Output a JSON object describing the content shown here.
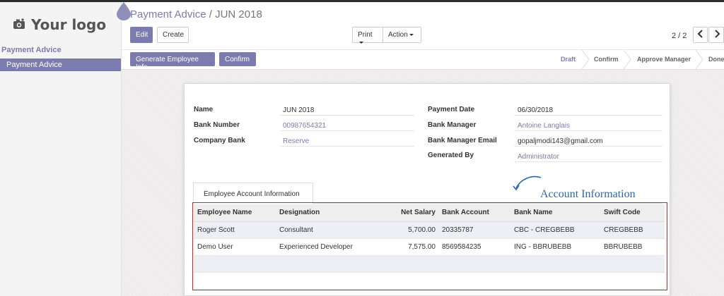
{
  "app": {
    "logo_text": "Your logo",
    "colors": {
      "accent": "#7c7bad",
      "annotation": "#2a67b0",
      "highlight_box": "#e02020"
    }
  },
  "sidebar": {
    "section_label": "Payment Advice",
    "items": [
      {
        "label": "Payment Advice",
        "active": true
      }
    ]
  },
  "breadcrumb": {
    "parent": "Payment Advice",
    "separator": "/",
    "current": "JUN 2018"
  },
  "toolbar": {
    "edit": "Edit",
    "create": "Create",
    "print": "Print",
    "action": "Action"
  },
  "pager": {
    "text": "2 / 2",
    "prev_icon": "chevron-left-icon",
    "next_icon": "chevron-right-icon"
  },
  "header_buttons": {
    "generate": "Generate Employee Info",
    "confirm": "Confirm"
  },
  "states": [
    {
      "label": "Draft",
      "active": true
    },
    {
      "label": "Confirm",
      "active": false
    },
    {
      "label": "Approve Manager",
      "active": false
    },
    {
      "label": "Done",
      "active": false
    }
  ],
  "form": {
    "left": [
      {
        "label": "Name",
        "value": "JUN 2018",
        "link": false
      },
      {
        "label": "Bank Number",
        "value": "00987654321",
        "link": true
      },
      {
        "label": "Company Bank",
        "value": "Reserve",
        "link": true
      }
    ],
    "right": [
      {
        "label": "Payment Date",
        "value": "06/30/2018",
        "link": false
      },
      {
        "label": "Bank Manager",
        "value": "Antoine Langlais",
        "link": true
      },
      {
        "label": "Bank Manager Email",
        "value": "gopaljmodi143@gmail.com",
        "link": false
      },
      {
        "label": "Generated By",
        "value": "Administrator",
        "link": true
      }
    ]
  },
  "tab": {
    "label": "Employee Account Information"
  },
  "annotation": {
    "text": "Account Information"
  },
  "table": {
    "columns": [
      "Employee Name",
      "Designation",
      "Net Salary",
      "Bank Account",
      "Bank Name",
      "Swift Code"
    ],
    "rows": [
      [
        "Roger Scott",
        "Consultant",
        "5,700.00",
        "20335787",
        "CBC - CREGBEBB",
        "CREGBEBB"
      ],
      [
        "Demo User",
        "Experienced Developer",
        "7,575.00",
        "8569584235",
        "ING - BBRUBEBB",
        "BBRUBEBB"
      ]
    ]
  }
}
